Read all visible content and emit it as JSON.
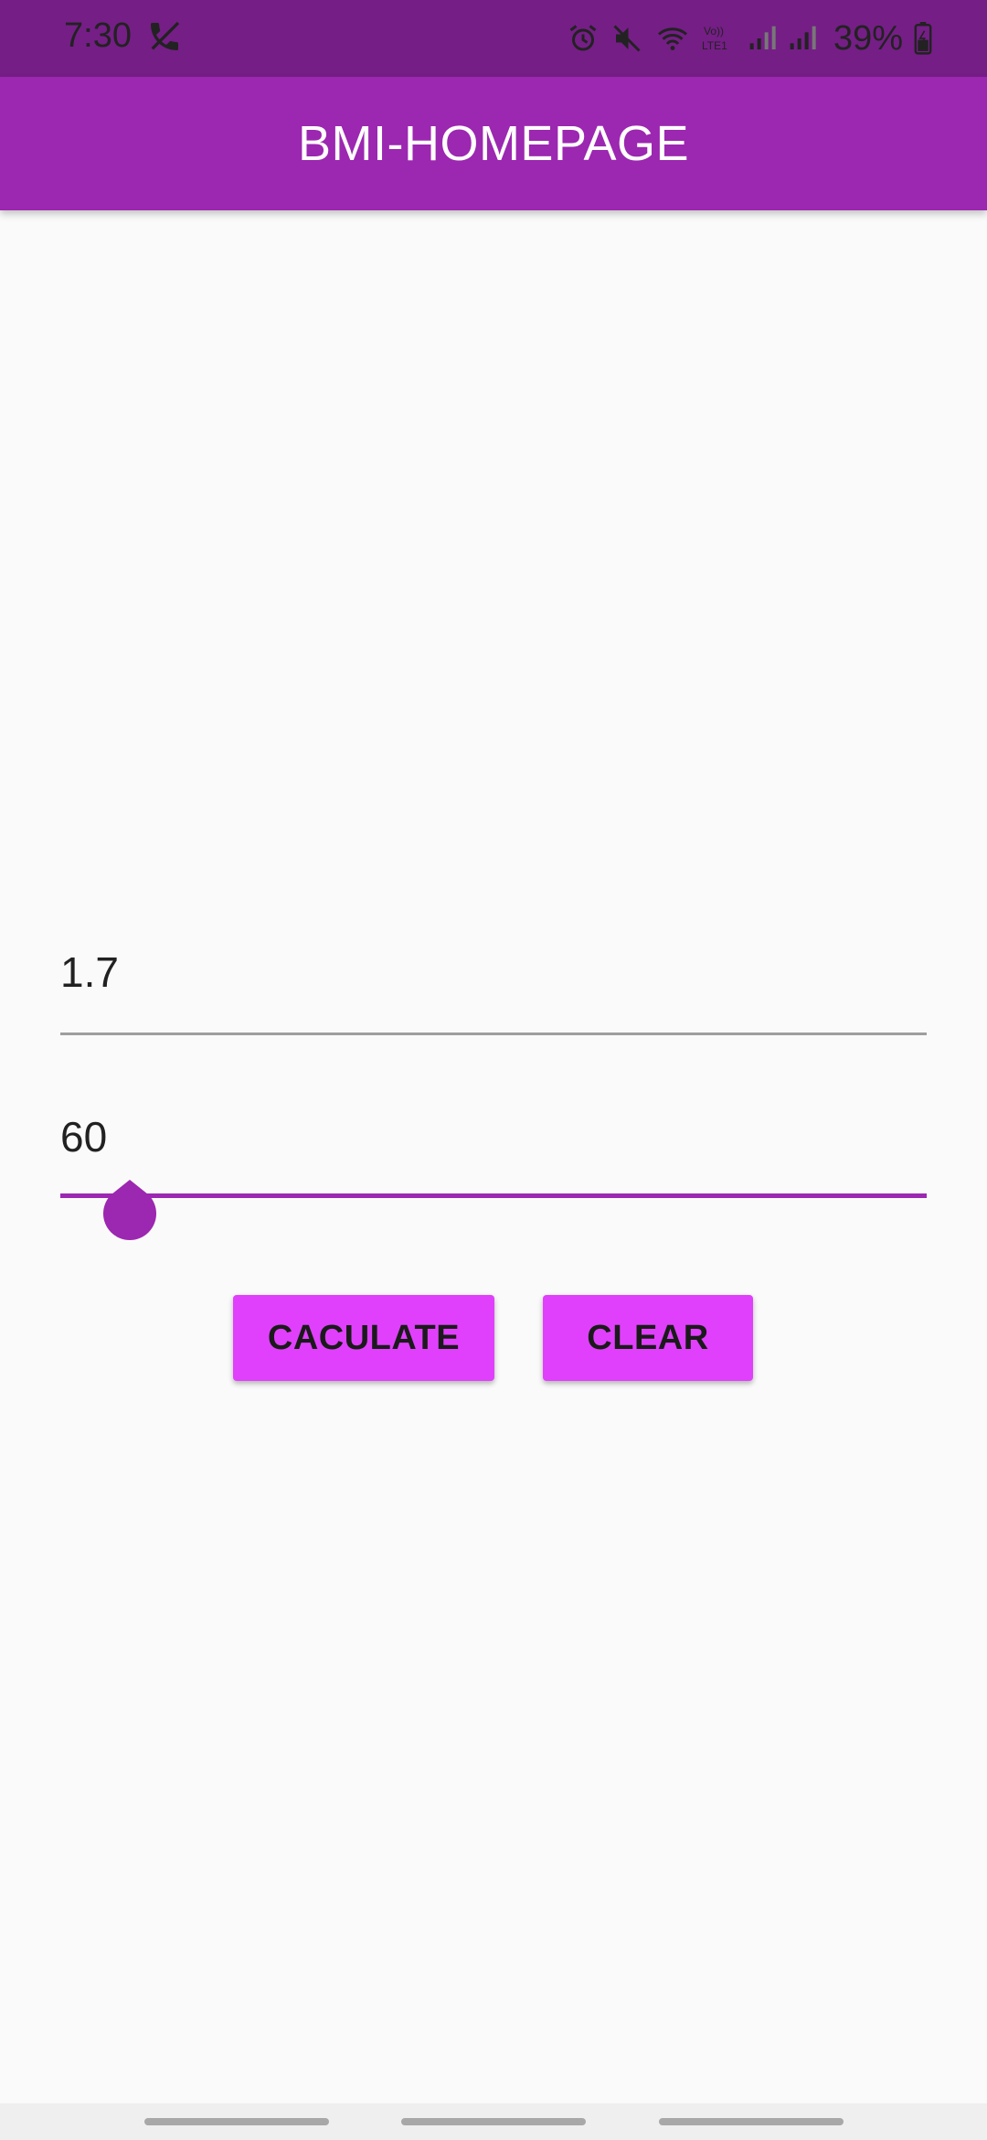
{
  "status_bar": {
    "time": "7:30",
    "battery": "39%",
    "icons": [
      "call-muted-icon",
      "alarm-icon",
      "vibrate-off-icon",
      "wifi-icon",
      "volte-icon",
      "signal-icon",
      "signal-icon-2",
      "battery-icon"
    ]
  },
  "app_bar": {
    "title": "BMI-HOMEPAGE",
    "color": "#9c27b0"
  },
  "form": {
    "height_value": "1.7",
    "weight_value": "60",
    "weight_slider_fraction": 0.05
  },
  "buttons": {
    "calculate_label": "CACULATE",
    "clear_label": "CLEAR",
    "color": "#e040fb"
  }
}
